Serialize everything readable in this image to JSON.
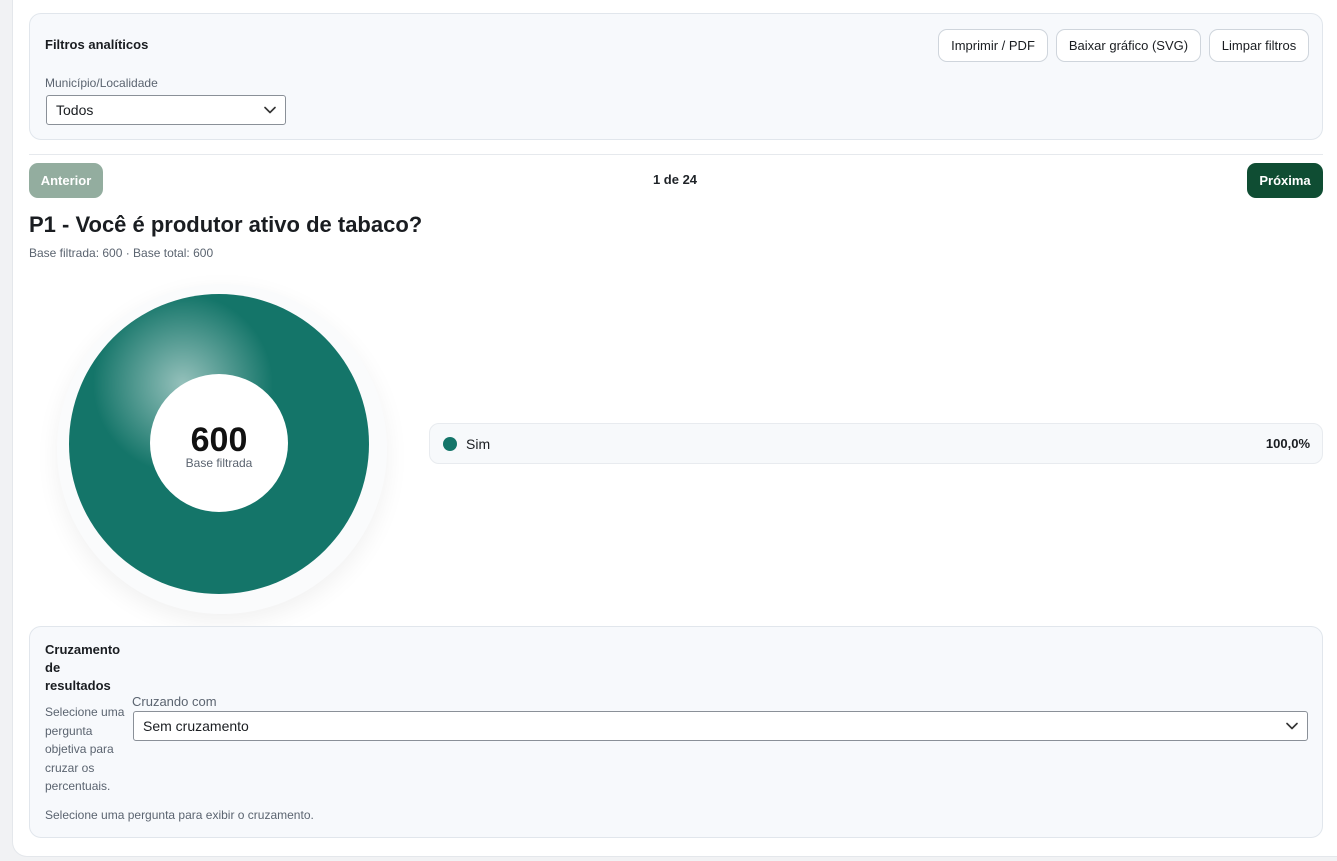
{
  "filters": {
    "title": "Filtros analíticos",
    "municipality_label": "Município/Localidade",
    "municipality_value": "Todos",
    "print_button": "Imprimir / PDF",
    "download_button": "Baixar gráfico (SVG)",
    "clear_button": "Limpar filtros"
  },
  "navigation": {
    "prev_label": "Anterior",
    "counter": "1 de 24",
    "next_label": "Próxima"
  },
  "question": {
    "title": "P1 - Você é produtor ativo de tabaco?",
    "subtitle": "Base filtrada: 600 · Base total: 600"
  },
  "chart_data": {
    "type": "pie",
    "center_value": "600",
    "center_label": "Base filtrada",
    "slices": [
      {
        "label": "Sim",
        "value": 100.0,
        "display": "100,0%",
        "color": "#147569"
      }
    ]
  },
  "crossing": {
    "title": "Cruzamento de resultados",
    "description": "Selecione uma pergunta objetiva para cruzar os percentuais.",
    "select_label": "Cruzando com",
    "select_value": "Sem cruzamento",
    "empty_message": "Selecione uma pergunta para exibir o cruzamento."
  },
  "icons": {
    "select_chevron": "chevron-down-icon"
  }
}
